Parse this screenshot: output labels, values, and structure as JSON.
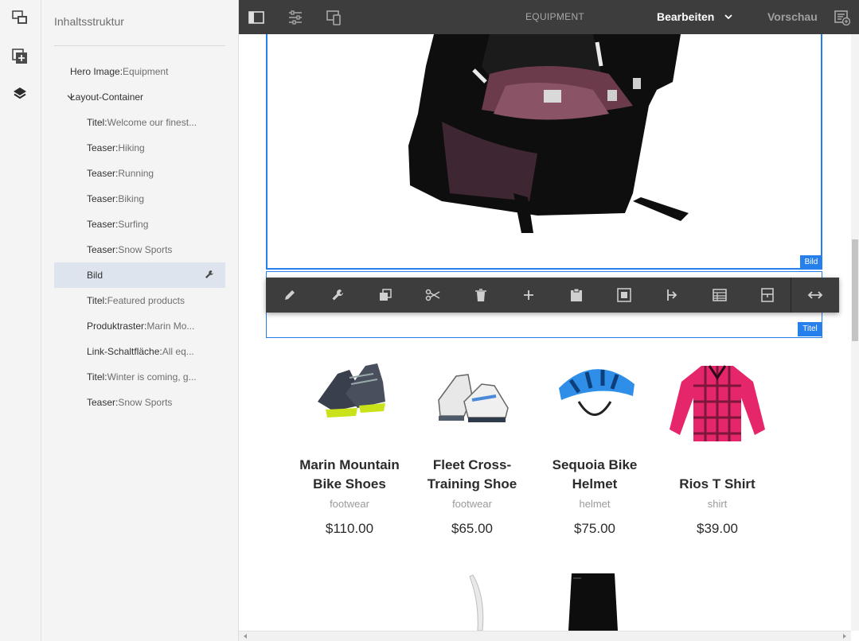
{
  "panel": {
    "title": "Inhaltsstruktur",
    "items": [
      {
        "type": "Hero Image",
        "name": "Equipment",
        "level": 0
      },
      {
        "type": "Layout-Container",
        "name": "",
        "level": 0,
        "expanded": true
      },
      {
        "type": "Titel",
        "name": "Welcome our finest...",
        "level": 1
      },
      {
        "type": "Teaser",
        "name": "Hiking",
        "level": 1
      },
      {
        "type": "Teaser",
        "name": "Running",
        "level": 1
      },
      {
        "type": "Teaser",
        "name": "Biking",
        "level": 1
      },
      {
        "type": "Teaser",
        "name": "Surfing",
        "level": 1
      },
      {
        "type": "Teaser",
        "name": "Snow Sports",
        "level": 1
      },
      {
        "type": "Bild",
        "name": "",
        "level": 1,
        "selected": true
      },
      {
        "type": "Titel",
        "name": "Featured products",
        "level": 1
      },
      {
        "type": "Produktraster",
        "name": "Marin Mo...",
        "level": 1
      },
      {
        "type": "Link-Schaltfläche",
        "name": "All eq...",
        "level": 1
      },
      {
        "type": "Titel",
        "name": "Winter is coming, g...",
        "level": 1
      },
      {
        "type": "Teaser",
        "name": "Snow Sports",
        "level": 1
      }
    ]
  },
  "topbar": {
    "page_title": "EQUIPMENT",
    "mode_label": "Bearbeiten",
    "preview_label": "Vorschau"
  },
  "editor": {
    "image_label": "Bild",
    "title_label": "Titel",
    "toolbar_icons": [
      "pencil-icon",
      "wrench-icon",
      "copy-icon",
      "cut-icon",
      "trash-icon",
      "plus-icon",
      "clipboard-icon",
      "group-icon",
      "parent-icon",
      "layout-icon",
      "template-icon",
      "resize-icon"
    ]
  },
  "products": [
    {
      "name": "Marin Mountain Bike Shoes",
      "category": "footwear",
      "price": "$110.00"
    },
    {
      "name": "Fleet Cross-Training Shoe",
      "category": "footwear",
      "price": "$65.00"
    },
    {
      "name": "Sequoia Bike Helmet",
      "category": "helmet",
      "price": "$75.00"
    },
    {
      "name": "Rios T Shirt",
      "category": "shirt",
      "price": "$39.00"
    }
  ],
  "colors": {
    "accent": "#2680eb",
    "topbar": "#3d3d3d",
    "panel": "#f4f4f4"
  }
}
